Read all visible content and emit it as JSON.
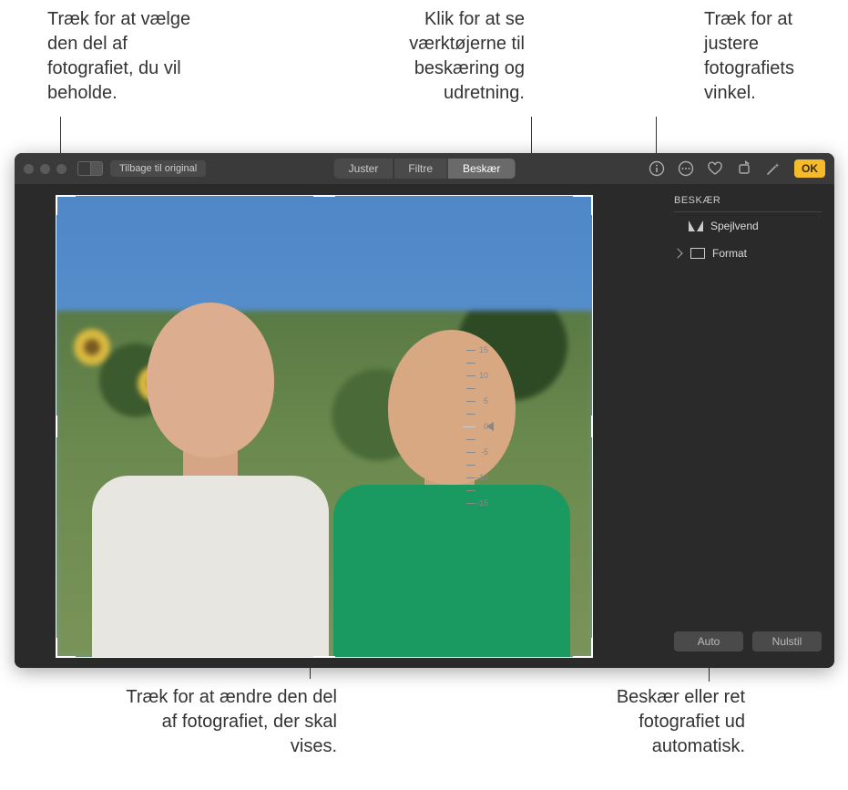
{
  "callouts": {
    "crop_drag": "Træk for at vælge den del af fotografiet, du vil beholde.",
    "crop_tab": "Klik for at se værktøjerne til beskæring og udretning.",
    "angle": "Træk for at justere fotografiets vinkel.",
    "reposition": "Træk for at ændre den del af fotografiet, der skal vises.",
    "auto": "Beskær eller ret fotografiet ud automatisk."
  },
  "toolbar": {
    "back_to_original": "Tilbage til original",
    "tabs": {
      "adjust": "Juster",
      "filters": "Filtre",
      "crop": "Beskær"
    },
    "ok": "OK"
  },
  "sidebar": {
    "title": "BESKÆR",
    "flip": "Spejlvend",
    "aspect": "Format",
    "auto": "Auto",
    "reset": "Nulstil"
  },
  "dial": {
    "labels": [
      "15",
      "10",
      "5",
      "0",
      "-5",
      "-10",
      "-15"
    ]
  }
}
